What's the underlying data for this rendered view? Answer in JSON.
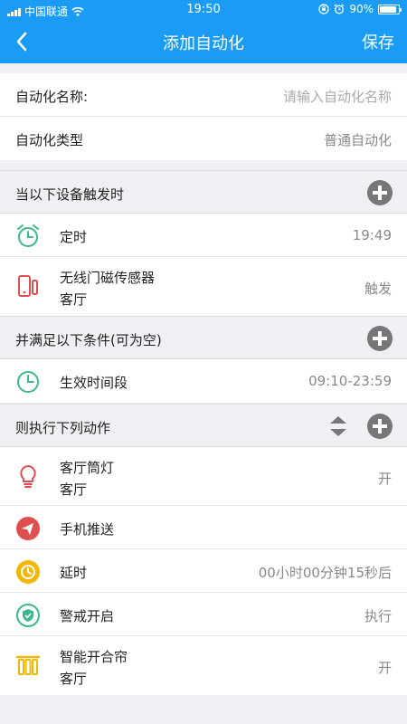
{
  "status_bar": {
    "carrier": "中国联通",
    "time": "19:50",
    "battery": "90%",
    "battery_level": 0.9,
    "icons": [
      "signal-icon",
      "wifi-icon",
      "rotation-lock-icon",
      "alarm-icon",
      "battery-icon"
    ]
  },
  "nav": {
    "title": "添加自动化",
    "save_label": "保存",
    "back_icon": "back-chevron-icon"
  },
  "settings": {
    "name_label": "自动化名称:",
    "name_placeholder": "请输入自动化名称",
    "type_label": "自动化类型",
    "type_value": "普通自动化"
  },
  "triggers": {
    "title": "当以下设备触发时",
    "items": [
      {
        "name": "定时",
        "value": "19:49",
        "icon": "alarm-clock-icon"
      },
      {
        "name": "无线门磁传感器",
        "sub": "客厅",
        "value": "触发",
        "icon": "door-sensor-icon"
      }
    ]
  },
  "conditions": {
    "title": "并满足以下条件(可为空)",
    "items": [
      {
        "name": "生效时间段",
        "value": "09:10-23:59",
        "icon": "clock-icon"
      }
    ]
  },
  "actions": {
    "title": "则执行下列动作",
    "items": [
      {
        "name": "客厅筒灯",
        "sub": "客厅",
        "value": "开",
        "icon": "light-bulb-icon"
      },
      {
        "name": "手机推送",
        "value": "",
        "icon": "paper-plane-icon"
      },
      {
        "name": "延时",
        "value": "00小时00分钟15秒后",
        "icon": "timer-icon"
      },
      {
        "name": "警戒开启",
        "value": "执行",
        "icon": "shield-icon"
      },
      {
        "name": "智能开合帘",
        "sub": "客厅",
        "value": "开",
        "icon": "curtain-icon"
      }
    ]
  },
  "colors": {
    "primary": "#1a9cf4",
    "background": "#efeff4",
    "green": "#3cb88a",
    "red": "#e04f4f",
    "yellow": "#f2b705"
  }
}
